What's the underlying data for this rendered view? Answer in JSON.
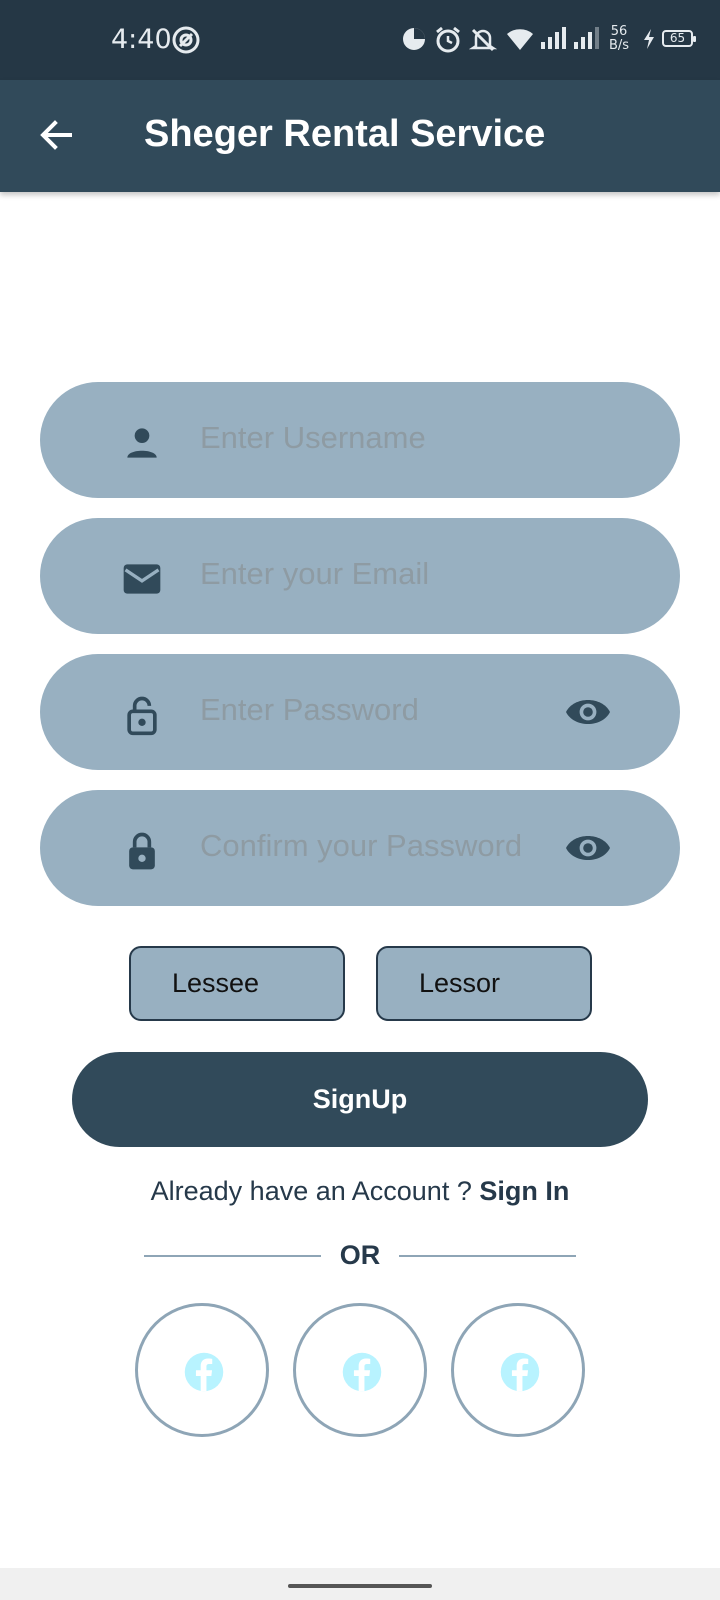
{
  "status_bar": {
    "time": "4:40",
    "net_speed_value": "56",
    "net_speed_unit": "B/s",
    "battery": "65"
  },
  "app_bar": {
    "title": "Sheger Rental Service",
    "back_icon": "arrow-left-icon"
  },
  "form": {
    "username": {
      "placeholder": "Enter Username",
      "value": "",
      "icon": "person-icon"
    },
    "email": {
      "placeholder": "Enter your Email",
      "value": "",
      "icon": "mail-icon"
    },
    "password": {
      "placeholder": "Enter Password",
      "value": "",
      "icon": "lock-open-icon",
      "toggle_icon": "eye-icon"
    },
    "confirm_password": {
      "placeholder": "Confirm your Password",
      "value": "",
      "icon": "lock-icon",
      "toggle_icon": "eye-icon"
    }
  },
  "roles": {
    "lessee": "Lessee",
    "lessor": "Lessor"
  },
  "signup_label": "SignUp",
  "account_prompt": "Already have an Account ?",
  "signin_label": "Sign In",
  "divider_label": "OR",
  "social_buttons": [
    {
      "icon": "facebook-icon"
    },
    {
      "icon": "facebook-icon"
    },
    {
      "icon": "facebook-icon"
    }
  ],
  "colors": {
    "status_bar": "#253745",
    "primary": "#314a5a",
    "field_fill": "#98b0c1",
    "placeholder": "#8e9ba3",
    "social_icon": "#b8f3ff"
  }
}
